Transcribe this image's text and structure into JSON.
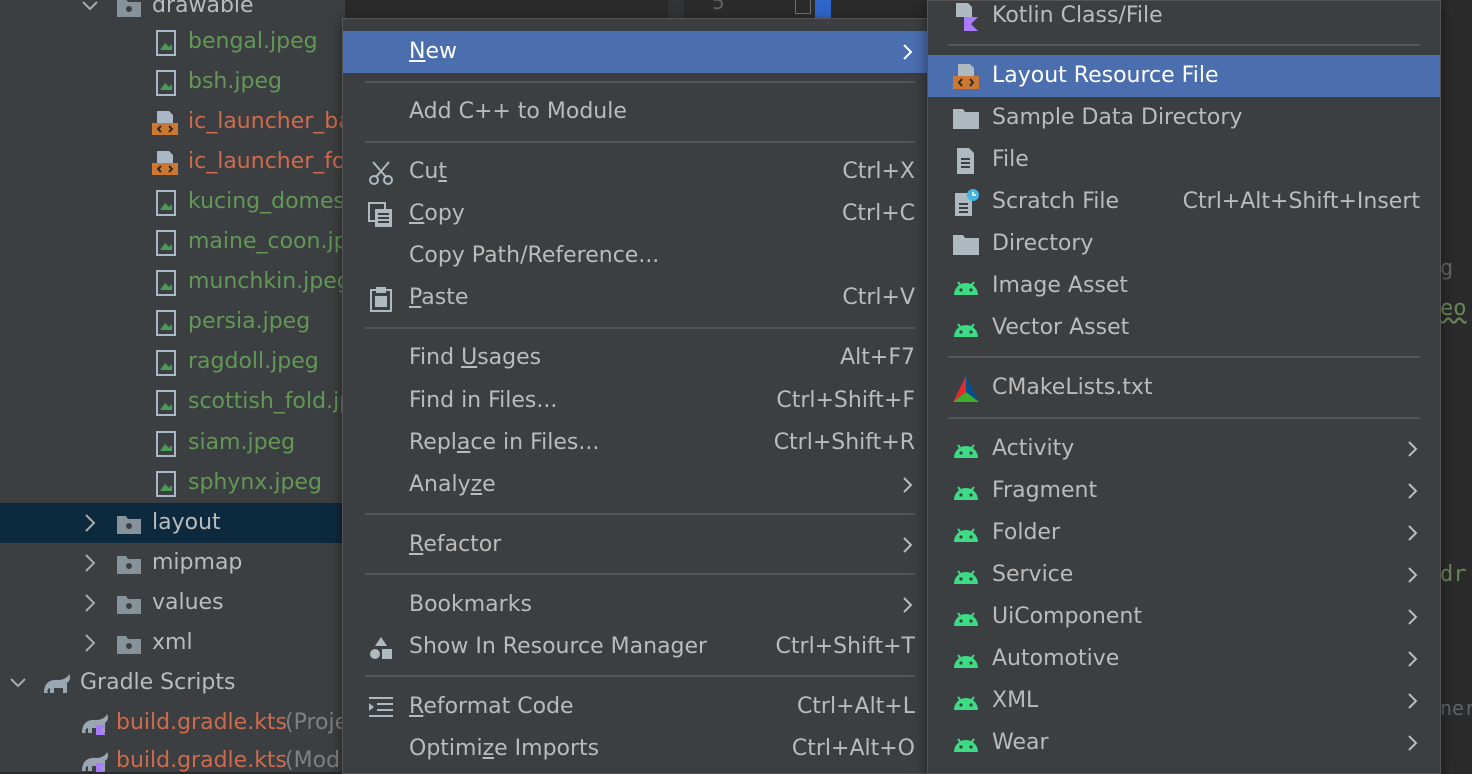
{
  "tree": {
    "partial_top_folder": "drawable",
    "files": [
      {
        "name": "bengal.jpeg",
        "kind": "image"
      },
      {
        "name": "bsh.jpeg",
        "kind": "image"
      },
      {
        "name": "ic_launcher_ba",
        "kind": "xml"
      },
      {
        "name": "ic_launcher_fo",
        "kind": "xml"
      },
      {
        "name": "kucing_domes",
        "kind": "image"
      },
      {
        "name": "maine_coon.jp",
        "kind": "image"
      },
      {
        "name": "munchkin.jpeg",
        "kind": "image"
      },
      {
        "name": "persia.jpeg",
        "kind": "image"
      },
      {
        "name": "ragdoll.jpeg",
        "kind": "image"
      },
      {
        "name": "scottish_fold.jp",
        "kind": "image"
      },
      {
        "name": "siam.jpeg",
        "kind": "image"
      },
      {
        "name": "sphynx.jpeg",
        "kind": "image"
      }
    ],
    "folders": [
      "layout",
      "mipmap",
      "values",
      "xml"
    ],
    "gradle_scripts": "Gradle Scripts",
    "gradle_files": [
      {
        "name": "build.gradle.kts",
        "suffix": "(Proje"
      },
      {
        "name": "build.gradle.kts",
        "suffix": "(Mod"
      }
    ]
  },
  "editor": {
    "line_number_fragment": "5",
    "right_fragments": [
      "g",
      "eo",
      "dr",
      "ner"
    ]
  },
  "context_menu": {
    "new": {
      "pre": "",
      "u": "N",
      "post": "ew"
    },
    "add_cpp": "Add C++ to Module",
    "cut": {
      "pre": "Cu",
      "u": "t",
      "post": "",
      "shortcut": "Ctrl+X"
    },
    "copy": {
      "pre": "",
      "u": "C",
      "post": "opy",
      "shortcut": "Ctrl+C"
    },
    "copy_path": "Copy Path/Reference...",
    "paste": {
      "pre": "",
      "u": "P",
      "post": "aste",
      "shortcut": "Ctrl+V"
    },
    "find_usages": {
      "pre": "Find ",
      "u": "U",
      "post": "sages",
      "shortcut": "Alt+F7"
    },
    "find_in_files": {
      "label": "Find in Files...",
      "shortcut": "Ctrl+Shift+F"
    },
    "replace_in_files": {
      "pre": "Repl",
      "u": "a",
      "post": "ce in Files...",
      "shortcut": "Ctrl+Shift+R"
    },
    "analyze": {
      "pre": "Analy",
      "u": "z",
      "post": "e"
    },
    "refactor": {
      "pre": "",
      "u": "R",
      "post": "efactor"
    },
    "bookmarks": "Bookmarks",
    "show_in_resource_manager": {
      "label": "Show In Resource Manager",
      "shortcut": "Ctrl+Shift+T"
    },
    "reformat_code": {
      "pre": "",
      "u": "R",
      "post": "eformat Code",
      "shortcut": "Ctrl+Alt+L"
    },
    "optimize_imports": {
      "pre": "Optimi",
      "u": "z",
      "post": "e Imports",
      "shortcut": "Ctrl+Alt+O"
    }
  },
  "new_submenu": {
    "kotlin_class": "Kotlin Class/File",
    "layout_resource": "Layout Resource File",
    "sample_data": "Sample Data Directory",
    "file": "File",
    "scratch_file": {
      "label": "Scratch File",
      "shortcut": "Ctrl+Alt+Shift+Insert"
    },
    "directory": "Directory",
    "image_asset": "Image Asset",
    "vector_asset": "Vector Asset",
    "cmake": "CMakeLists.txt",
    "activity": "Activity",
    "fragment": "Fragment",
    "folder": "Folder",
    "service": "Service",
    "ui_component": "UiComponent",
    "automotive": "Automotive",
    "xml": "XML",
    "wear": "Wear"
  },
  "colors": {
    "menu_bg": "#3c3f41",
    "highlight": "#4b6eaf",
    "selected_row": "#0d293e",
    "image_file": "#629755",
    "xml_file": "#cf6a4c",
    "android_green": "#3ddc84"
  }
}
